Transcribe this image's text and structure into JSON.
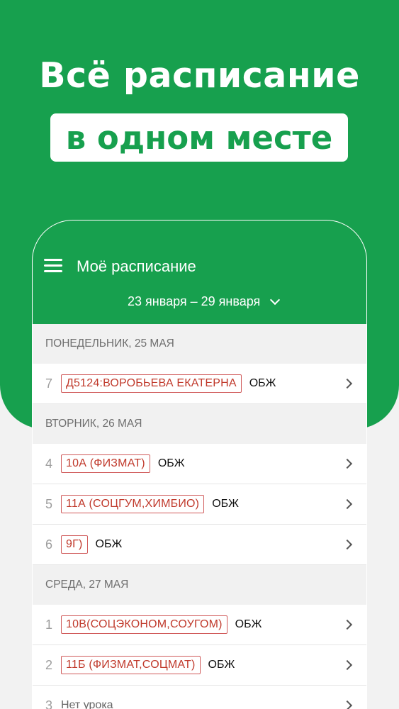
{
  "hero": {
    "title": "Всё расписание",
    "subtitle": "в одном месте"
  },
  "appbar": {
    "title": "Моё расписание",
    "week": "23 января – 29 января"
  },
  "days": [
    {
      "header": "ПОНЕДЕЛЬНИК, 25 МАЯ",
      "lessons": [
        {
          "num": "7",
          "group": "Д5124:ВОРОБЬЕВА ЕКАТЕРНА",
          "subject": "ОБЖ"
        }
      ]
    },
    {
      "header": "ВТОРНИК, 26 МАЯ",
      "lessons": [
        {
          "num": "4",
          "group": "10А (ФИЗМАТ)",
          "subject": "ОБЖ"
        },
        {
          "num": "5",
          "group": "11А (СОЦГУМ,ХИМБИО)",
          "subject": "ОБЖ"
        },
        {
          "num": "6",
          "group": "9Г)",
          "subject": "ОБЖ"
        }
      ]
    },
    {
      "header": "СРЕДА, 27 МАЯ",
      "lessons": [
        {
          "num": "1",
          "group": "10В(СОЦЭКОНОМ,СОУГОМ)",
          "subject": "ОБЖ"
        },
        {
          "num": "2",
          "group": "11Б (ФИЗМАТ,СОЦМАТ)",
          "subject": "ОБЖ"
        },
        {
          "num": "3",
          "empty_text": "Нет урока"
        }
      ]
    }
  ],
  "colors": {
    "accent": "#17a04e",
    "group_tag": "#c0392b"
  },
  "icons": {
    "menu": "hamburger-menu-icon",
    "week_toggle": "chevron-down-icon",
    "row_arrow": "chevron-right-icon"
  }
}
